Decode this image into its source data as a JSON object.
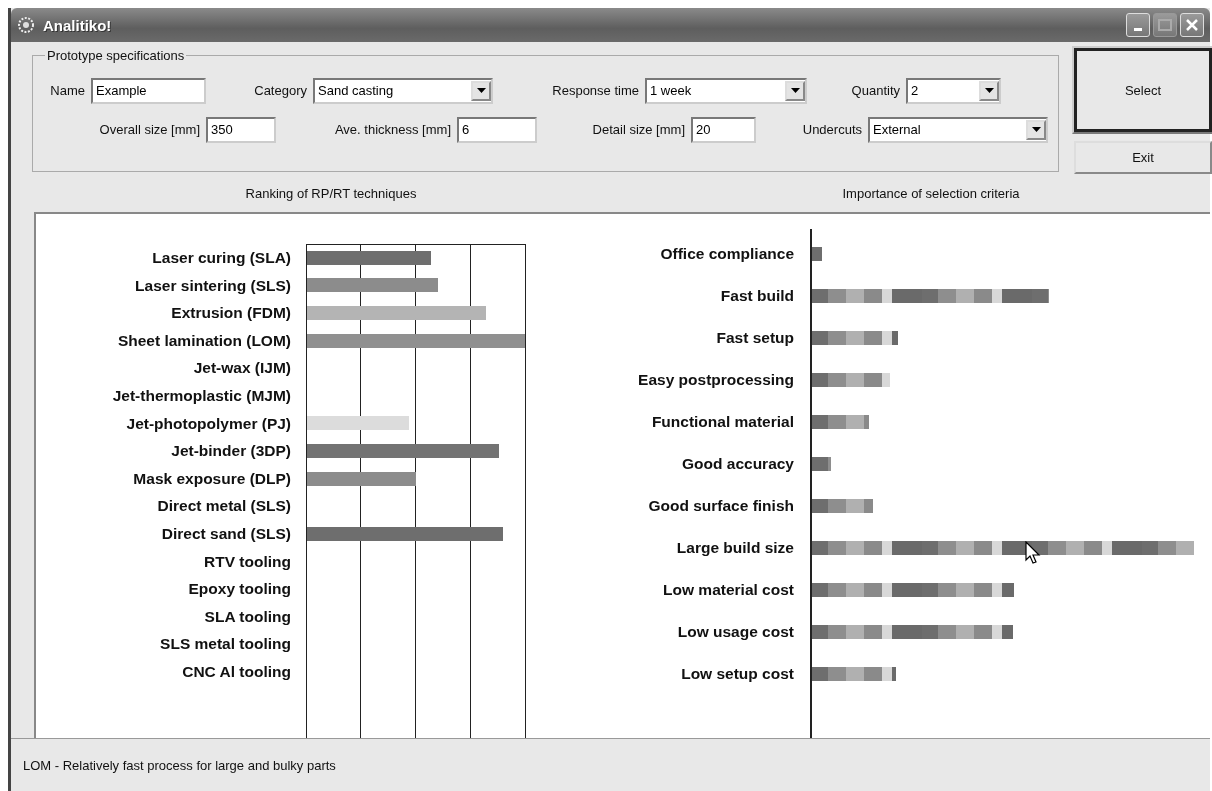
{
  "window": {
    "title": "Analitiko!"
  },
  "specifications": {
    "title": "Prototype specifications",
    "rows": [
      [
        {
          "label": "Name",
          "kind": "text",
          "value": "Example"
        },
        {
          "label": "Category",
          "kind": "dropdown",
          "value": "Sand casting"
        },
        {
          "label": "Response time",
          "kind": "dropdown",
          "value": "1 week"
        },
        {
          "label": "Quantity",
          "kind": "dropdown",
          "value": "2"
        }
      ],
      [
        {
          "label": "Overall size [mm]",
          "kind": "text",
          "value": "350"
        },
        {
          "label": "Ave. thickness [mm]",
          "kind": "text",
          "value": "6"
        },
        {
          "label": "Detail size [mm]",
          "kind": "text",
          "value": "20"
        },
        {
          "label": "Undercuts",
          "kind": "dropdown",
          "value": "External"
        }
      ]
    ]
  },
  "buttons": [
    {
      "label": "Select",
      "default": true
    },
    {
      "label": "Exit",
      "default": false
    }
  ],
  "ranking": {
    "title": "Ranking of RP/RT techniques",
    "techniques": [
      {
        "label": "Laser curing (SLA)",
        "level": 0.57,
        "color": "#6e6e6e"
      },
      {
        "label": "Laser sintering (SLS)",
        "level": 0.6,
        "color": "#8c8c8c"
      },
      {
        "label": "Extrusion (FDM)",
        "level": 0.82,
        "color": "#b4b4b4"
      },
      {
        "label": "Sheet lamination (LOM)",
        "level": 1,
        "color": "#909090"
      },
      {
        "label": "Jet-wax (IJM)"
      },
      {
        "label": "Jet-thermoplastic (MJM)"
      },
      {
        "label": "Jet-photopolymer (PJ)",
        "level": 0.47,
        "color": "#dcdcdc"
      },
      {
        "label": "Jet-binder (3DP)",
        "level": 0.88,
        "color": "#737373"
      },
      {
        "label": "Mask exposure (DLP)",
        "level": 0.5,
        "color": "#8c8c8c"
      },
      {
        "label": "Direct metal (SLS)"
      },
      {
        "label": "Direct sand (SLS)",
        "level": 0.9,
        "color": "#6e6e6e"
      },
      {
        "label": "RTV tooling"
      },
      {
        "label": "Epoxy tooling"
      },
      {
        "label": "SLA tooling"
      },
      {
        "label": "SLS metal tooling"
      },
      {
        "label": "CNC Al tooling"
      }
    ]
  },
  "criteria": {
    "title": "Importance of selection criteria",
    "items": [
      {
        "label": "Office compliance",
        "level": 0.025
      },
      {
        "label": "Fast build",
        "level": 0.62
      },
      {
        "label": "Fast setup",
        "level": 0.225
      },
      {
        "label": "Easy postprocessing",
        "level": 0.205
      },
      {
        "label": "Functional material",
        "level": 0.15
      },
      {
        "label": "Good accuracy",
        "level": 0.05
      },
      {
        "label": "Good surface finish",
        "level": 0.16
      },
      {
        "label": "Large build size",
        "level": 1
      },
      {
        "label": "Low material cost",
        "level": 0.53
      },
      {
        "label": "Low usage cost",
        "level": 0.525
      },
      {
        "label": "Low setup cost",
        "level": 0.22
      }
    ]
  },
  "status_bar": "LOM - Relatively fast process for large and bulky parts"
}
